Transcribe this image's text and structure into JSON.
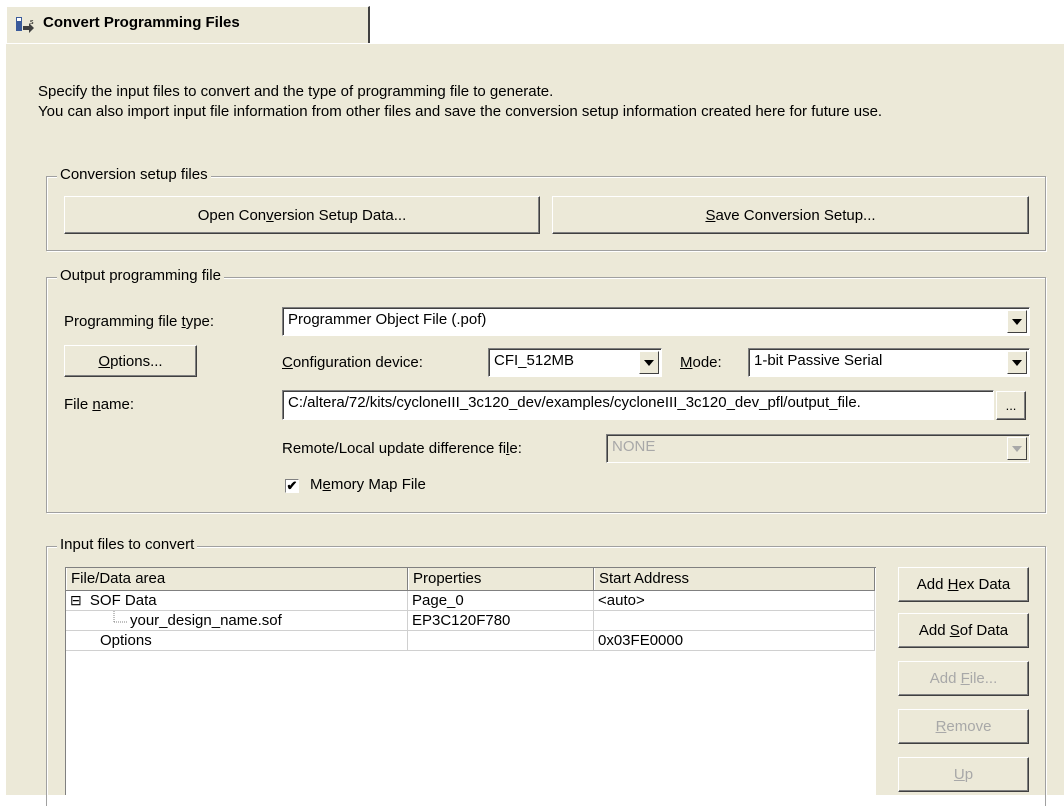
{
  "tab": {
    "title": "Convert Programming Files"
  },
  "intro": {
    "line1": "Specify the input files to convert and the type of programming file to generate.",
    "line2": "You can also import input file information from other files and save the conversion setup information created here for future use."
  },
  "setup": {
    "legend": "Conversion setup files",
    "open_button": "Open Conversion Setup Data...",
    "save_button": "Save Conversion Setup..."
  },
  "output": {
    "legend": "Output programming file",
    "file_type_label": "Programming file type:",
    "file_type_value": "Programmer Object File (.pof)",
    "options_button": "Options...",
    "config_device_label": "Configuration device:",
    "config_device_value": "CFI_512MB",
    "mode_label": "Mode:",
    "mode_value": "1-bit Passive Serial",
    "file_name_label": "File name:",
    "file_name_value": "C:/altera/72/kits/cycloneIII_3c120_dev/examples/cycloneIII_3c120_dev_pfl/output_file.",
    "browse_button": "...",
    "remote_label": "Remote/Local update difference file:",
    "remote_value": "NONE",
    "memory_map_label": "Memory Map File",
    "memory_map_checked": true
  },
  "input": {
    "legend": "Input files to convert",
    "columns": [
      "File/Data area",
      "Properties",
      "Start Address"
    ],
    "rows": [
      {
        "name": "SOF Data",
        "properties": "Page_0",
        "address": "<auto>",
        "expander": "⊟"
      },
      {
        "name": "your_design_name.sof",
        "properties": "EP3C120F780",
        "address": ""
      },
      {
        "name": "Options",
        "properties": "",
        "address": "0x03FE0000"
      }
    ],
    "buttons": {
      "add_hex": "Add Hex Data",
      "add_sof": "Add Sof Data",
      "add_file": "Add File...",
      "remove": "Remove",
      "up": "Up"
    }
  },
  "colors": {
    "panel": "#ece9d8",
    "disabled_text": "#a8a8a8"
  }
}
